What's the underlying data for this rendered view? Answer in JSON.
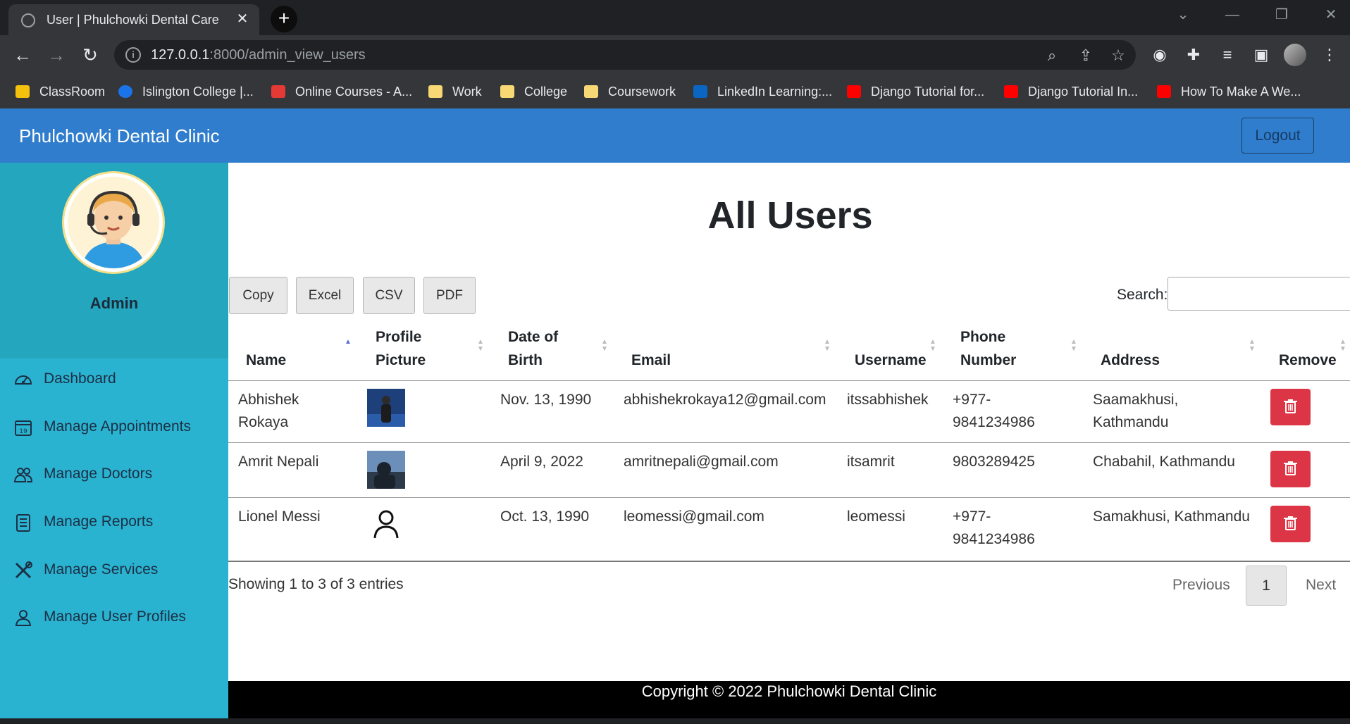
{
  "browser": {
    "tab_title": "User | Phulchowki Dental Care",
    "url_host": "127.0.0.1",
    "url_path": ":8000/admin_view_users",
    "bookmarks": [
      {
        "label": "ClassRoom",
        "color": "#f4c20d"
      },
      {
        "label": "Islington College |...",
        "color": "#1a73e8"
      },
      {
        "label": "Online Courses - A...",
        "color": "#e53935"
      },
      {
        "label": "Work",
        "color": "#f8d775"
      },
      {
        "label": "College",
        "color": "#f8d775"
      },
      {
        "label": "Coursework",
        "color": "#f8d775"
      },
      {
        "label": "LinkedIn Learning:...",
        "color": "#0a66c2"
      },
      {
        "label": "Django Tutorial for...",
        "color": "#ff0000"
      },
      {
        "label": "Django Tutorial In...",
        "color": "#ff0000"
      },
      {
        "label": "How To Make A We...",
        "color": "#ff0000"
      }
    ]
  },
  "navbar": {
    "brand": "Phulchowki Dental Clinic",
    "logout": "Logout",
    "color": "#2f7dcc"
  },
  "sidebar": {
    "admin_name": "Admin",
    "items": [
      {
        "label": "Dashboard",
        "icon": "speedometer-icon"
      },
      {
        "label": "Manage Appointments",
        "icon": "calendar-icon"
      },
      {
        "label": "Manage Doctors",
        "icon": "people-icon"
      },
      {
        "label": "Manage Reports",
        "icon": "report-icon"
      },
      {
        "label": "Manage Services",
        "icon": "tools-icon"
      },
      {
        "label": "Manage User Profiles",
        "icon": "person-icon"
      }
    ]
  },
  "main": {
    "heading": "All Users",
    "export_buttons": [
      "Copy",
      "Excel",
      "CSV",
      "PDF"
    ],
    "search_label": "Search:",
    "columns": [
      {
        "line1": "Name",
        "line2": ""
      },
      {
        "line1": "Profile",
        "line2": "Picture"
      },
      {
        "line1": "Date of",
        "line2": "Birth"
      },
      {
        "line1": "Email",
        "line2": ""
      },
      {
        "line1": "Username",
        "line2": ""
      },
      {
        "line1": "Phone",
        "line2": "Number"
      },
      {
        "line1": "Address",
        "line2": ""
      },
      {
        "line1": "Remove",
        "line2": ""
      }
    ],
    "rows": [
      {
        "name_1": "Abhishek",
        "name_2": "Rokaya",
        "dob": "Nov. 13, 1990",
        "email": "abhishekrokaya12@gmail.com",
        "username": "itssabhishek",
        "phone_1": "+977-",
        "phone_2": "9841234986",
        "address_1": "Saamakhusi,",
        "address_2": "Kathmandu"
      },
      {
        "name_1": "Amrit Nepali",
        "name_2": "",
        "dob": "April 9, 2022",
        "email": "amritnepali@gmail.com",
        "username": "itsamrit",
        "phone_1": "9803289425",
        "phone_2": "",
        "address_1": "Chabahil, Kathmandu",
        "address_2": ""
      },
      {
        "name_1": "Lionel Messi",
        "name_2": "",
        "dob": "Oct. 13, 1990",
        "email": "leomessi@gmail.com",
        "username": "leomessi",
        "phone_1": "+977-",
        "phone_2": "9841234986",
        "address_1": "Samakhusi, Kathmandu",
        "address_2": ""
      }
    ],
    "info": "Showing 1 to 3 of 3 entries",
    "pagination": {
      "previous": "Previous",
      "page": "1",
      "next": "Next"
    },
    "delete_color": "#dc3545"
  },
  "footer": {
    "text": "Copyright © 2022 Phulchowki Dental Clinic"
  }
}
